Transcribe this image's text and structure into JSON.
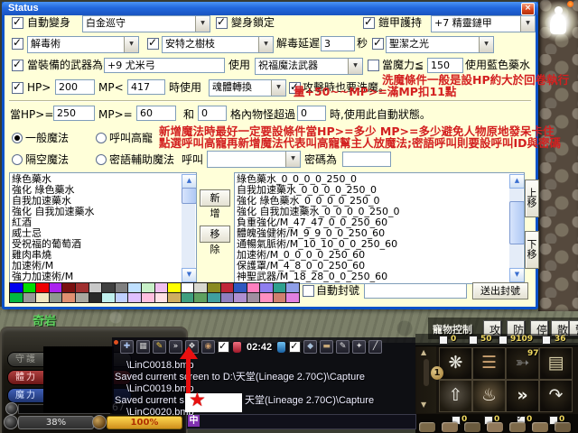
{
  "window": {
    "title": "Status",
    "close_icon": "×"
  },
  "r1": {
    "auto": "自動變身",
    "auto_val": "白金巡守",
    "lock": "變身鎖定",
    "armor": "鎧甲護持",
    "armor_val": "+7 精靈鏈甲"
  },
  "r2": {
    "detox_val": "解毒術",
    "branch_val": "安特之樹枝",
    "delay": "解毒延遲",
    "delay_val": "3",
    "sec": "秒",
    "holy_val": "聖潔之光"
  },
  "r3": {
    "weapon_cond": "當裝備的武器為",
    "weapon_val": "+9 尤米弓",
    "use": "使用",
    "bless_val": "祝福魔法武器",
    "mana_cond": "當魔力≦",
    "mana_val": "150",
    "blue": "使用藍色藥水"
  },
  "hint1a": "洗魔條件一般是設HP約大於回卷執行",
  "hint1b": "量+50~~MP>=滿MP扣11點",
  "r4": {
    "hp": "HP>",
    "hp_val": "200",
    "mp": "MP<",
    "mp_val": "417",
    "when": "時使用",
    "soul_val": "魂體轉換",
    "wash": "攻擊時也要洗魔。"
  },
  "cond": {
    "hp": "當HP>=",
    "hp_val": "250",
    "mp": "MP>=",
    "mp_val": "60",
    "and": "和",
    "and_val": "0",
    "grid": "格內物怪超過",
    "grid_val": "0",
    "tail": "時,使用此自動狀態。"
  },
  "hint2a": "新增魔法時最好一定要設條件當HP>=多少 MP>=多少避免人物原地發呆卡住",
  "hint2b": "點選呼叫高寵再新增魔法代表叫高寵幫主人放魔法;密語呼叫則要設呼叫ID與密碼",
  "radios": {
    "normal": "一般魔法",
    "pet": "呼叫高寵",
    "ranged": "隔空魔法",
    "whisper": "密語輔助魔法",
    "call": "呼叫",
    "pw": "密碼為"
  },
  "left_list": [
    "綠色藥水",
    "強化 綠色藥水",
    "自我加速藥水",
    "強化 自我加速藥水",
    "紅酒",
    "威士忌",
    "受祝福的葡萄酒",
    "雞肉串燒",
    "加速術/M",
    "強力加速術/M"
  ],
  "right_list": [
    "綠色藥水_0_0_0_0_250_0",
    "自我加速藥水_0_0_0_0_250_0",
    "強化 綠色藥水_0_0_0_0_250_0",
    "強化 自我加速藥水_0_0_0_0_250_0",
    "負重強化/M_47_47_0_0_250_60",
    "體魄強健術/M_9_9_0_0_250_60",
    "通暢氣脈術/M_10_10_0_0_250_60",
    "加速術/M_0_0_0_0_250_60",
    "保護罩/M_4_8_0_0_250_60",
    "神聖武器/M_18_28_0_0_250_60"
  ],
  "btns": {
    "add": "新增",
    "remove": "移除",
    "up": "上移",
    "down": "下移",
    "send": "送出封號",
    "auto_title": "自動封號"
  },
  "palette1": [
    "#0000ee",
    "#00dd00",
    "#ee0000",
    "#aa22ee",
    "#7a1010",
    "#a03030",
    "#c8c8c8",
    "#404040",
    "#808080",
    "#bfe0ff",
    "#c8f0c8",
    "#f0c0f0",
    "#ffff00",
    "#ffffff",
    "#d8d8d0",
    "#8a8a20",
    "#c02838",
    "#3058c0",
    "#ff7fbf",
    "#8f7fef",
    "#2fa08f",
    "#8f9fe8"
  ],
  "palette2": [
    "#00b840",
    "#989898",
    "#f0e6c0",
    "#8f988f",
    "#e08f70",
    "#a8a8a0",
    "#282828",
    "#c0f0ee",
    "#bfd0ff",
    "#dfc0ff",
    "#ffbfdf",
    "#ffe0e6",
    "#cfae5f",
    "#3f9f7f",
    "#5fa05f",
    "#3f9f9f",
    "#8f7fc0",
    "#af8fd0",
    "#9f8fa0",
    "#ff8fc0",
    "#d07f6f",
    "#e07fe0"
  ],
  "game": {
    "location": "奇岩",
    "panel": {
      "p1": "守護",
      "hp": "體力",
      "mp": "魔力",
      "level": "67",
      "weight": "38%",
      "food": "100%"
    },
    "chat": {
      "time": "02:42",
      "l1": "\\LinC0018.bmp",
      "l2": "Saved current screen to D:\\天堂(Lineage 2.70C)\\Capture",
      "l3": "\\LinC0019.bmp",
      "l4a": "Saved current s",
      "l4b": "天堂(Lineage 2.70C)\\Capture",
      "l5": "\\LinC0020.bmp",
      "ime": "中",
      "star": "★"
    },
    "pet": {
      "label": "寵物控制",
      "buttons": [
        "攻",
        "防",
        "停",
        "散",
        "警"
      ]
    },
    "counts": [
      "0",
      "50",
      "9109",
      "36"
    ],
    "counts2": [
      "0",
      "0",
      "0",
      "0"
    ],
    "hotbar_count": "97",
    "item_colors": [
      "#7a6848",
      "#8a7252",
      "#6a5a3e",
      "#90785a",
      "#7e6a4a",
      "#86704e",
      "#6e5c40"
    ]
  },
  "icons": {
    "toolbar1": [
      {
        "g": "✚",
        "c": "#aac4f0"
      },
      {
        "g": "▦",
        "c": "#c8c8c8"
      },
      {
        "g": "✎",
        "c": "#f0c840"
      },
      {
        "g": "»",
        "c": "#f4f4f4"
      },
      {
        "g": "❖",
        "c": "#d8d8d8"
      },
      {
        "g": "◉",
        "c": "#c89868"
      }
    ],
    "toolbar2": [
      {
        "g": "◆",
        "c": "#a8c0d8"
      },
      {
        "g": "▬",
        "c": "#c8a878"
      },
      {
        "g": "✎",
        "c": "#e0e0e0"
      },
      {
        "g": "✦",
        "c": "#d8d8d8"
      },
      {
        "g": "╱",
        "c": "#e8e8e8"
      }
    ],
    "hotbar": [
      {
        "g": "❋"
      },
      {
        "g": "☰"
      },
      {
        "g": "➳"
      },
      {
        "g": "▤"
      },
      {
        "g": "⇧"
      },
      {
        "g": "♨"
      },
      {
        "g": "»"
      },
      {
        "g": "↷"
      }
    ],
    "updown": {
      "up": "▲",
      "down": "▼"
    }
  }
}
